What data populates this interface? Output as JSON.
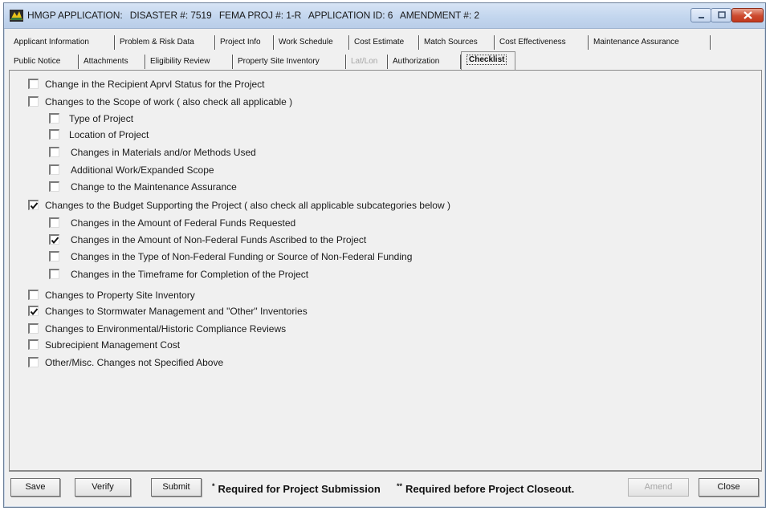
{
  "window": {
    "title_parts": [
      "HMGP APPLICATION:",
      "DISASTER #: 7519",
      "FEMA PROJ #: 1-R",
      "APPLICATION ID: 6",
      "AMENDMENT #: 2"
    ]
  },
  "tabs_row1": [
    {
      "label": "Applicant Information"
    },
    {
      "label": "Problem & Risk Data"
    },
    {
      "label": "Project Info"
    },
    {
      "label": "Work Schedule"
    },
    {
      "label": "Cost Estimate"
    },
    {
      "label": "Match Sources"
    },
    {
      "label": "Cost Effectiveness"
    },
    {
      "label": "Maintenance Assurance"
    }
  ],
  "tabs_row2": [
    {
      "label": "Public Notice"
    },
    {
      "label": "Attachments"
    },
    {
      "label": "Eligibility Review"
    },
    {
      "label": "Property Site Inventory"
    },
    {
      "label": "Lat/Lon",
      "disabled": true
    },
    {
      "label": "Authorization"
    },
    {
      "label": "Checklist",
      "active": true
    }
  ],
  "checklist": [
    {
      "label": "Change in the Recipient Aprvl Status for the Project",
      "checked": false
    },
    {
      "label": "Changes to the Scope of work ( also check all applicable )",
      "checked": false
    },
    {
      "label": "Type of Project",
      "checked": false
    },
    {
      "label": "Location of Project",
      "checked": false
    },
    {
      "label": "Changes in Materials and/or Methods Used",
      "checked": false
    },
    {
      "label": "Additional Work/Expanded Scope",
      "checked": false
    },
    {
      "label": "Change to the Maintenance Assurance",
      "checked": false
    },
    {
      "label": "Changes to the Budget Supporting the Project ( also check all applicable subcategories below )",
      "checked": true
    },
    {
      "label": "Changes in the Amount of Federal Funds Requested",
      "checked": false
    },
    {
      "label": "Changes in the Amount of Non-Federal Funds Ascribed to the Project",
      "checked": true
    },
    {
      "label": "Changes in the Type of Non-Federal Funding or Source of Non-Federal Funding",
      "checked": false
    },
    {
      "label": "Changes in the Timeframe for Completion of the Project",
      "checked": false
    },
    {
      "label": "Changes to Property Site Inventory",
      "checked": false
    },
    {
      "label": "Changes to Stormwater Management and \"Other\" Inventories",
      "checked": true
    },
    {
      "label": "Changes to Environmental/Historic Compliance Reviews",
      "checked": false
    },
    {
      "label": "Subrecipient Management Cost",
      "checked": false
    },
    {
      "label": "Other/Misc. Changes not Specified Above",
      "checked": false
    }
  ],
  "footer": {
    "save_label": "Save",
    "verify_label": "Verify",
    "submit_label": "Submit",
    "req_submission_mark": "*",
    "req_submission_text": "Required for Project Submission",
    "req_closeout_mark": "**",
    "req_closeout_text": "Required before Project Closeout.",
    "amend_label": "Amend",
    "close_label": "Close"
  }
}
